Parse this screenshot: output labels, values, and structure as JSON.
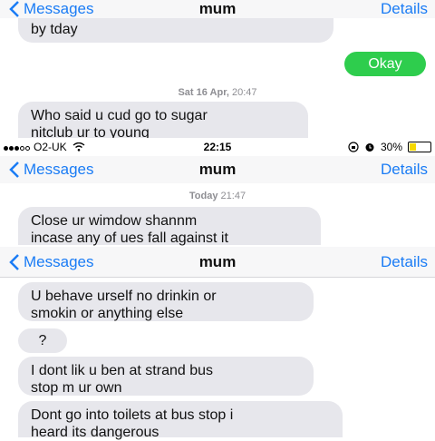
{
  "nav": {
    "back_label": "Messages",
    "contact": "mum",
    "details_label": "Details"
  },
  "section1": {
    "partial_bubble_text": "by tday",
    "outgoing": "Okay",
    "stamp_day": "Sat 16 Apr,",
    "stamp_time": "20:47",
    "incoming": [
      "Who said u cud go to sugar",
      "nitclub ur to young"
    ]
  },
  "status_bar": {
    "carrier": "O2-UK",
    "time": "22:15",
    "battery_percent_label": "30%",
    "battery_level": 0.3
  },
  "section2": {
    "stamp_day": "Today",
    "stamp_time": "21:47",
    "incoming": [
      "Close ur wimdow shannm",
      "incase any of ues fall against it"
    ]
  },
  "section3": {
    "messages": [
      [
        "U behave urself no drinkin or",
        "smokin or anything else"
      ],
      [
        "?"
      ],
      [
        "I dont lik u ben at strand bus",
        "stop m ur own"
      ],
      [
        "Dont go into toilets at bus stop i",
        "heard its dangerous"
      ]
    ]
  },
  "colors": {
    "accent": "#1a7cf5",
    "outgoing_bubble": "#2ecd4d",
    "incoming_bubble": "#e7e7ec",
    "battery": "#f6d800"
  }
}
